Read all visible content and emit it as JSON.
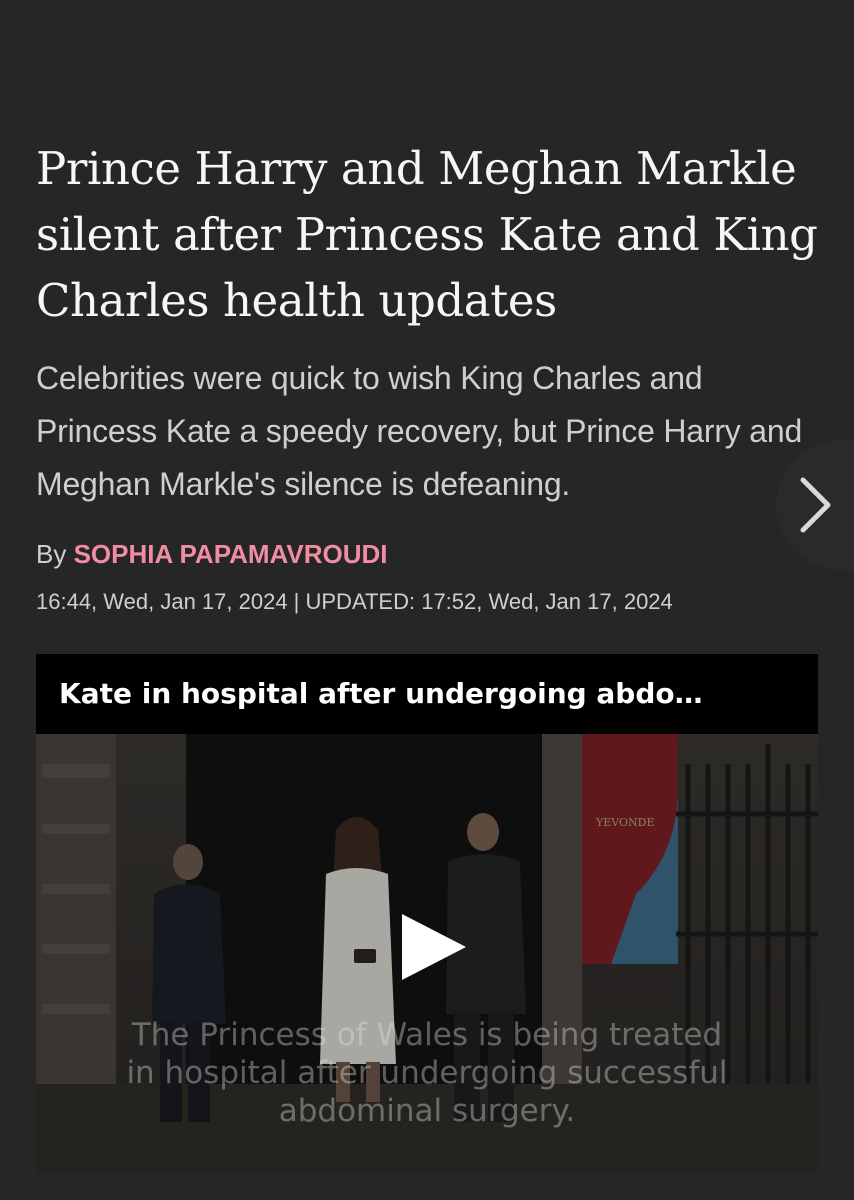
{
  "article": {
    "headline": "Prince Harry and Meghan Markle silent after Princess Kate and King Charles health updates",
    "subheadline": "Celebrities were quick to wish King Charles and Princess Kate a speedy recovery, but Prince Harry and Meghan Markle's silence is defeaning.",
    "byline_prefix": "By",
    "author": "SOPHIA PAPAMAVROUDI",
    "timestamp": "16:44, Wed, Jan 17, 2024 | UPDATED: 17:52, Wed, Jan 17, 2024"
  },
  "video": {
    "title": "Kate in hospital after undergoing abdo…",
    "caption_lines": [
      "The Princess of Wales is being treated",
      "in hospital after undergoing successful",
      "abdominal surgery."
    ],
    "play_icon": "play-icon"
  },
  "navigation": {
    "next_icon": "chevron-right-icon"
  },
  "colors": {
    "background": "#262627",
    "author_accent": "#f08da0",
    "text": "#f3f3f3",
    "muted_text": "#cfcfcf"
  }
}
